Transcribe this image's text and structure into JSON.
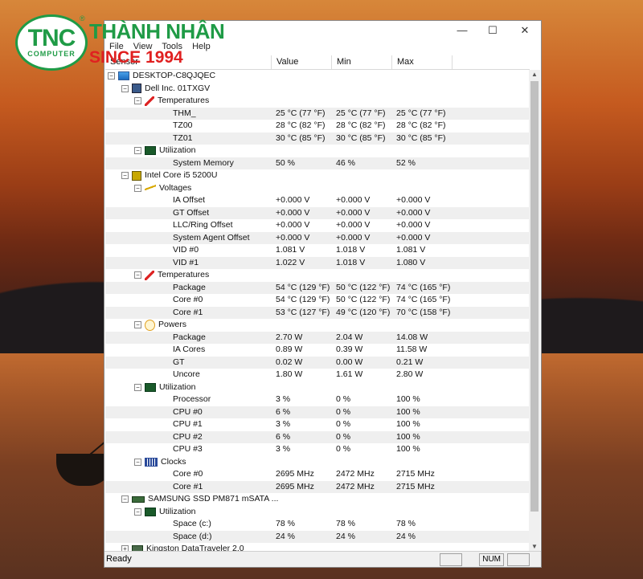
{
  "logo": {
    "mark": "TNC",
    "mark_sub": "COMPUTER",
    "registered": "®",
    "brand": "THÀNH NHÂN",
    "since": "SINCE 1994"
  },
  "window": {
    "menu": [
      "File",
      "View",
      "Tools",
      "Help"
    ],
    "columns": {
      "sensor": "Sensor",
      "value": "Value",
      "min": "Min",
      "max": "Max"
    },
    "status": {
      "ready": "Ready",
      "num": "NUM"
    }
  },
  "tree": [
    {
      "level": 0,
      "label": "DESKTOP-C8QJQEC",
      "icon": "computer-icon",
      "exp": "−"
    },
    {
      "level": 1,
      "label": "Dell Inc. 01TXGV",
      "icon": "motherboard-icon",
      "exp": "−"
    },
    {
      "level": 2,
      "label": "Temperatures",
      "icon": "thermometer-icon",
      "exp": "−"
    },
    {
      "level": 3,
      "label": "THM_",
      "value": "25 °C  (77 °F)",
      "min": "25 °C  (77 °F)",
      "max": "25 °C  (77 °F)"
    },
    {
      "level": 3,
      "label": "TZ00",
      "value": "28 °C  (82 °F)",
      "min": "28 °C  (82 °F)",
      "max": "28 °C  (82 °F)"
    },
    {
      "level": 3,
      "label": "TZ01",
      "value": "30 °C  (85 °F)",
      "min": "30 °C  (85 °F)",
      "max": "30 °C  (85 °F)"
    },
    {
      "level": 2,
      "label": "Utilization",
      "icon": "utilization-icon",
      "exp": "−"
    },
    {
      "level": 3,
      "label": "System Memory",
      "value": "50 %",
      "min": "46 %",
      "max": "52 %"
    },
    {
      "level": 1,
      "label": "Intel Core i5 5200U",
      "icon": "cpu-icon",
      "exp": "−"
    },
    {
      "level": 2,
      "label": "Voltages",
      "icon": "voltage-icon",
      "exp": "−"
    },
    {
      "level": 3,
      "label": "IA Offset",
      "value": "+0.000 V",
      "min": "+0.000 V",
      "max": "+0.000 V"
    },
    {
      "level": 3,
      "label": "GT Offset",
      "value": "+0.000 V",
      "min": "+0.000 V",
      "max": "+0.000 V"
    },
    {
      "level": 3,
      "label": "LLC/Ring Offset",
      "value": "+0.000 V",
      "min": "+0.000 V",
      "max": "+0.000 V"
    },
    {
      "level": 3,
      "label": "System Agent Offset",
      "value": "+0.000 V",
      "min": "+0.000 V",
      "max": "+0.000 V"
    },
    {
      "level": 3,
      "label": "VID #0",
      "value": "1.081 V",
      "min": "1.018 V",
      "max": "1.081 V"
    },
    {
      "level": 3,
      "label": "VID #1",
      "value": "1.022 V",
      "min": "1.018 V",
      "max": "1.080 V"
    },
    {
      "level": 2,
      "label": "Temperatures",
      "icon": "thermometer-icon",
      "exp": "−"
    },
    {
      "level": 3,
      "label": "Package",
      "value": "54 °C  (129 °F)",
      "min": "50 °C  (122 °F)",
      "max": "74 °C  (165 °F)"
    },
    {
      "level": 3,
      "label": "Core #0",
      "value": "54 °C  (129 °F)",
      "min": "50 °C  (122 °F)",
      "max": "74 °C  (165 °F)"
    },
    {
      "level": 3,
      "label": "Core #1",
      "value": "53 °C  (127 °F)",
      "min": "49 °C  (120 °F)",
      "max": "70 °C  (158 °F)"
    },
    {
      "level": 2,
      "label": "Powers",
      "icon": "power-icon",
      "exp": "−"
    },
    {
      "level": 3,
      "label": "Package",
      "value": "2.70 W",
      "min": "2.04 W",
      "max": "14.08 W"
    },
    {
      "level": 3,
      "label": "IA Cores",
      "value": "0.89 W",
      "min": "0.39 W",
      "max": "11.58 W"
    },
    {
      "level": 3,
      "label": "GT",
      "value": "0.02 W",
      "min": "0.00 W",
      "max": "0.21 W"
    },
    {
      "level": 3,
      "label": "Uncore",
      "value": "1.80 W",
      "min": "1.61 W",
      "max": "2.80 W"
    },
    {
      "level": 2,
      "label": "Utilization",
      "icon": "utilization-icon",
      "exp": "−"
    },
    {
      "level": 3,
      "label": "Processor",
      "value": "3 %",
      "min": "0 %",
      "max": "100 %"
    },
    {
      "level": 3,
      "label": "CPU #0",
      "value": "6 %",
      "min": "0 %",
      "max": "100 %"
    },
    {
      "level": 3,
      "label": "CPU #1",
      "value": "3 %",
      "min": "0 %",
      "max": "100 %"
    },
    {
      "level": 3,
      "label": "CPU #2",
      "value": "6 %",
      "min": "0 %",
      "max": "100 %"
    },
    {
      "level": 3,
      "label": "CPU #3",
      "value": "3 %",
      "min": "0 %",
      "max": "100 %"
    },
    {
      "level": 2,
      "label": "Clocks",
      "icon": "clock-icon",
      "exp": "−"
    },
    {
      "level": 3,
      "label": "Core #0",
      "value": "2695 MHz",
      "min": "2472 MHz",
      "max": "2715 MHz"
    },
    {
      "level": 3,
      "label": "Core #1",
      "value": "2695 MHz",
      "min": "2472 MHz",
      "max": "2715 MHz"
    },
    {
      "level": 1,
      "label": "SAMSUNG SSD PM871 mSATA ...",
      "icon": "ssd-icon",
      "exp": "−"
    },
    {
      "level": 2,
      "label": "Utilization",
      "icon": "utilization-icon",
      "exp": "−"
    },
    {
      "level": 3,
      "label": "Space (c:)",
      "value": "78 %",
      "min": "78 %",
      "max": "78 %"
    },
    {
      "level": 3,
      "label": "Space (d:)",
      "value": "24 %",
      "min": "24 %",
      "max": "24 %"
    },
    {
      "level": 1,
      "label": "Kingston DataTraveler 2.0",
      "icon": "usb-drive-icon",
      "exp": "+"
    }
  ]
}
